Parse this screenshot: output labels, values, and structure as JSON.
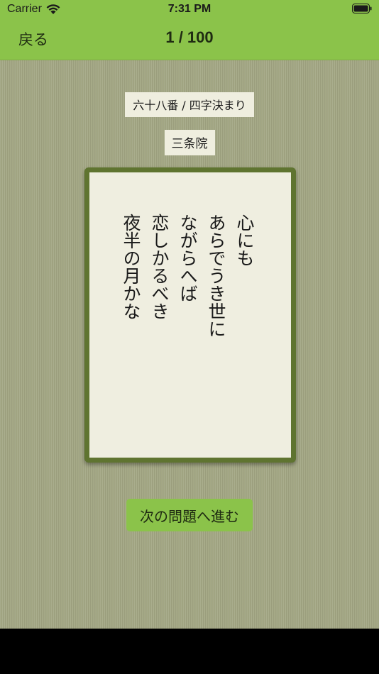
{
  "status_bar": {
    "carrier": "Carrier",
    "time": "7:31 PM",
    "wifi_icon": "wifi-icon",
    "battery_icon": "battery-icon"
  },
  "nav": {
    "back_label": "戻る",
    "progress": "1 / 100",
    "color": "#8bc34a"
  },
  "poem": {
    "label": "六十八番 / 四字決まり",
    "poet": "三条院",
    "lines": [
      "心にも",
      "あらでうき世に",
      "ながらへば",
      "恋しかるべき",
      "夜半の月かな"
    ]
  },
  "actions": {
    "next_label": "次の問題へ進む"
  },
  "colors": {
    "background": "#a3a784",
    "card_border": "#5f7430",
    "card_face": "#efeee0"
  }
}
